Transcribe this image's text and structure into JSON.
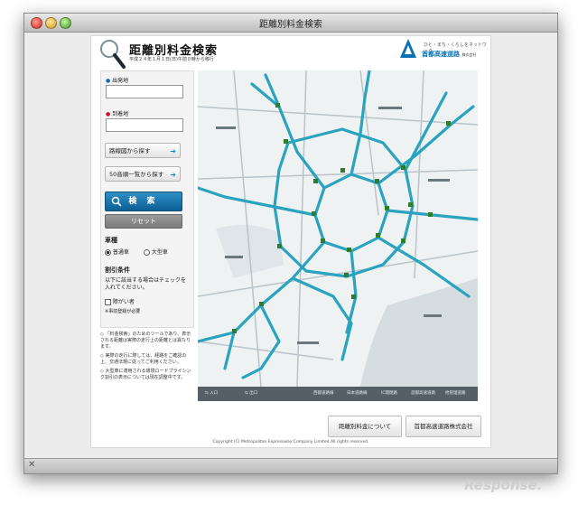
{
  "window": {
    "title": "距離別料金検索"
  },
  "header": {
    "title": "距離別料金検索",
    "date_note": "平成２４年１月１日(日)午前０時から移行",
    "logo_tagline": "ひと・まち・くらしをネットワーク",
    "logo_name": "首都高速道路",
    "logo_suffix": "株式会社"
  },
  "form": {
    "origin_label": "出発地",
    "origin_value": "",
    "destination_label": "到着地",
    "destination_value": "",
    "route_map_button": "路線図から探す",
    "kana_list_button": "50音順一覧から探す",
    "search_button": "検 索",
    "reset_button": "リセット",
    "vehicle_heading": "車種",
    "vehicle_options": [
      "普通車",
      "大型車"
    ],
    "vehicle_selected": "普通車",
    "discount_heading": "割引条件",
    "discount_note": "以下に該当する場合はチェックを入れてください。",
    "discount_option": "障がい者",
    "discount_footnote": "※事前登録が必要"
  },
  "notes": [
    "「料金検索」のためのツールであり、表示される距離は実際の走行上の距離とは異なります。",
    "実際の走行に際しては、経路をご確認の上、交通法規に従ってご利用ください。",
    "大型車に適用される環境ロードプライシング割引の表示については現在調整中です。"
  ],
  "map": {
    "legend": {
      "entrance": "入口",
      "exit": "出口",
      "items": [
        "西都道路線",
        "日本道路線",
        "IC開閉路",
        "首都高速道路",
        "他管理道路"
      ]
    }
  },
  "footer": {
    "about_button": "距離別料金について",
    "company_button": "首都高速道路株式会社",
    "copyright": "Copyright (C) Metropolitan Expressway Company Limited.All rights reserved."
  },
  "watermark": "Response."
}
